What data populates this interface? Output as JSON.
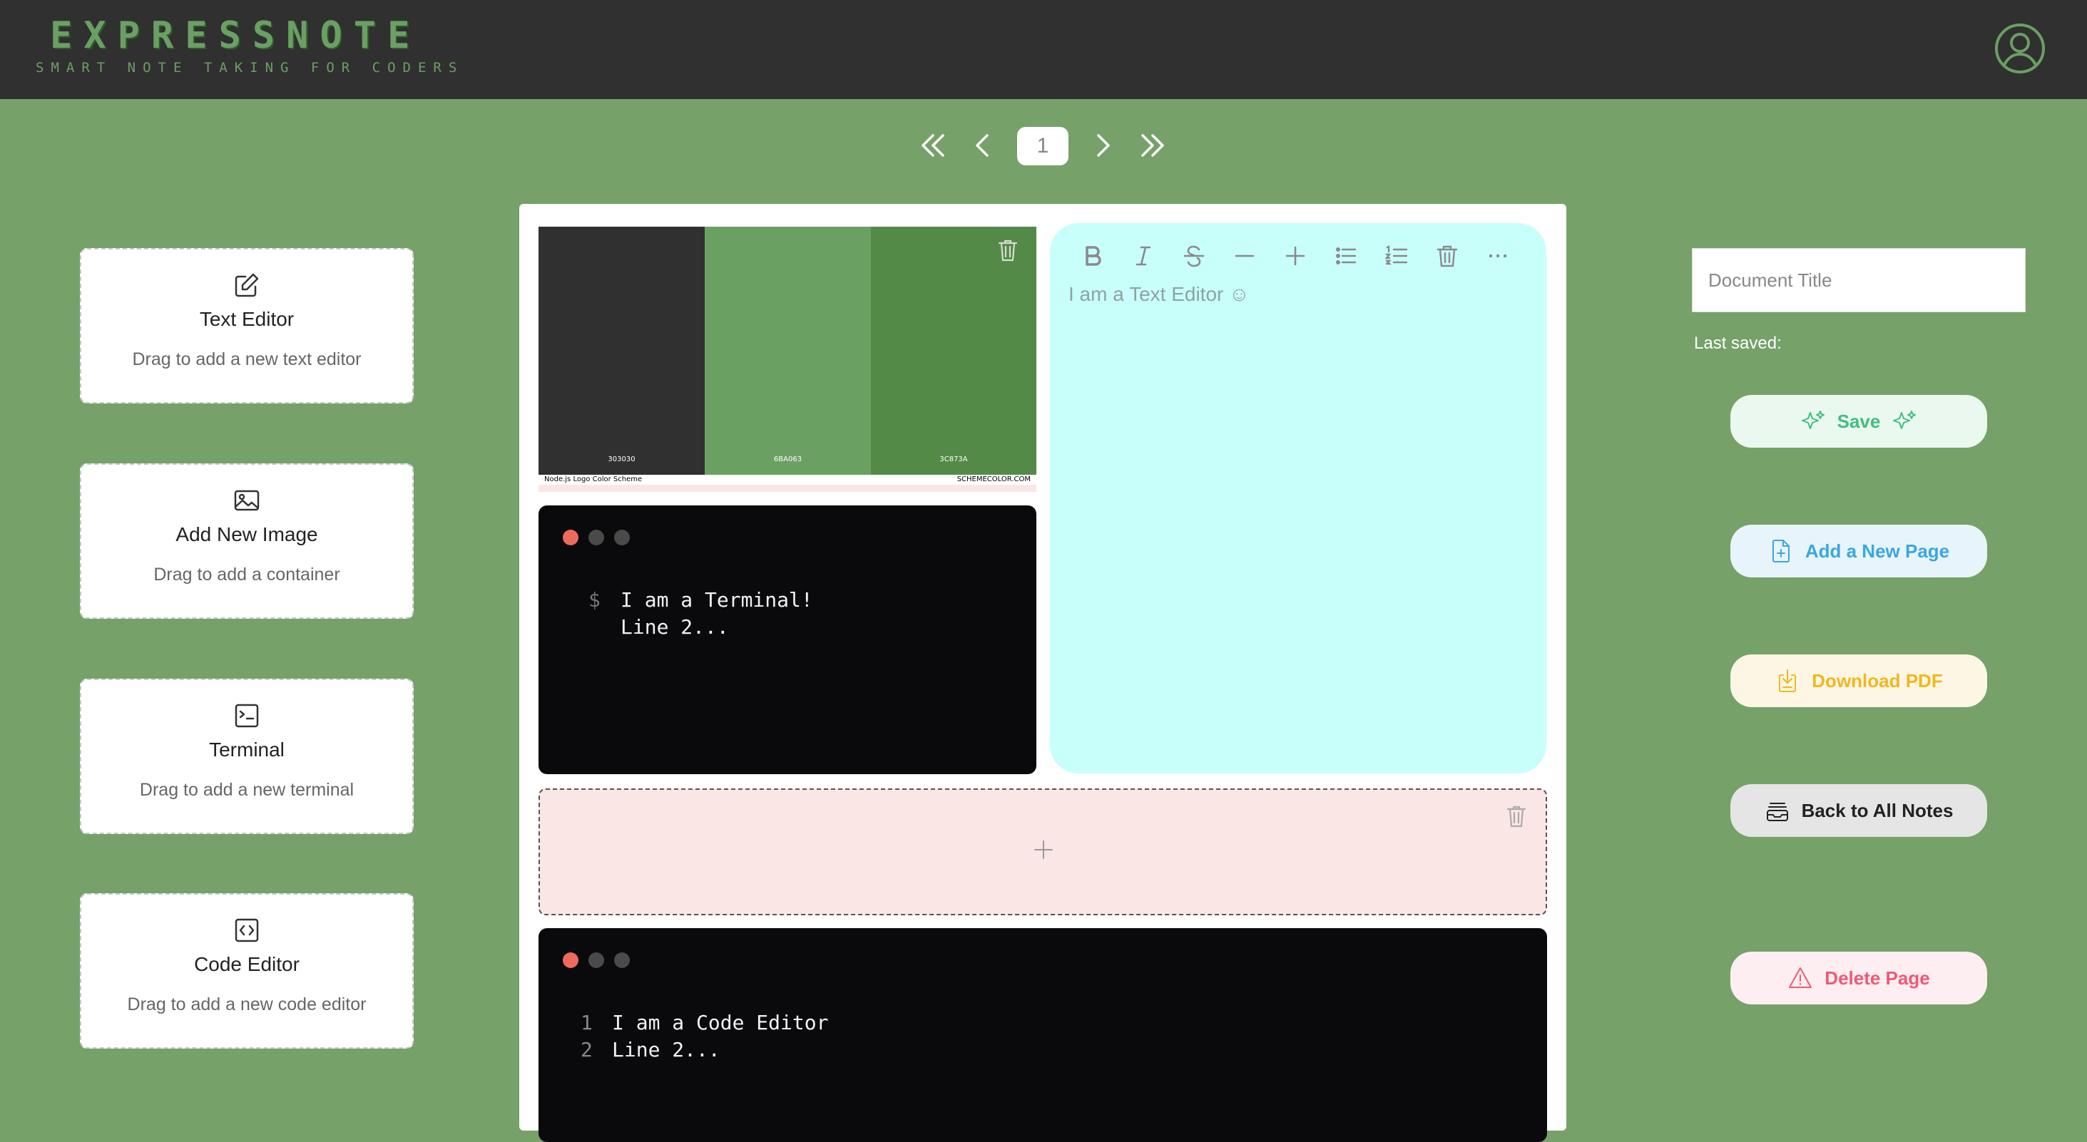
{
  "header": {
    "brand": "EXPRESSNOTE",
    "tagline": "SMART NOTE TAKING FOR CODERS",
    "avatar_icon": "user-circle-icon"
  },
  "pager": {
    "current_page": "1"
  },
  "palette_cards": [
    {
      "title": "Text Editor",
      "desc": "Drag to add a new text editor",
      "icon": "pencil-square-icon"
    },
    {
      "title": "Add New Image",
      "desc": "Drag to add a container",
      "icon": "image-icon"
    },
    {
      "title": "Terminal",
      "desc": "Drag to add a new terminal",
      "icon": "terminal-icon"
    },
    {
      "title": "Code Editor",
      "desc": "Drag to add a new code editor",
      "icon": "code-icon"
    }
  ],
  "image_block": {
    "swatches": [
      {
        "hex": "303030",
        "color": "#303030"
      },
      {
        "hex": "6BA063",
        "color": "#6ba063"
      },
      {
        "hex": "3C873A",
        "color": "#548a47"
      }
    ],
    "caption_left": "Node.js Logo Color Scheme",
    "caption_right": "SCHEMECOLOR.COM"
  },
  "terminal": {
    "prompt": "$",
    "line1": "I am a Terminal!",
    "line2": "Line 2..."
  },
  "text_editor": {
    "placeholder": "I am a Text Editor ☺"
  },
  "code_editor": {
    "line1_num": "1",
    "line1": "I am a Code Editor",
    "line2_num": "2",
    "line2": "Line 2..."
  },
  "sidebar": {
    "title_placeholder": "Document Title",
    "last_saved_label": "Last saved:",
    "save_label": "Save",
    "add_page_label": "Add a New Page",
    "download_label": "Download PDF",
    "back_label": "Back to All Notes",
    "delete_label": "Delete Page"
  },
  "colors": {
    "background": "#76a169",
    "header": "#303030",
    "brand": "#6aa063",
    "save": "#3fbf82",
    "add_page": "#3aa7e0",
    "download": "#f0b71f",
    "back": "#222222",
    "delete": "#ef5a77"
  }
}
